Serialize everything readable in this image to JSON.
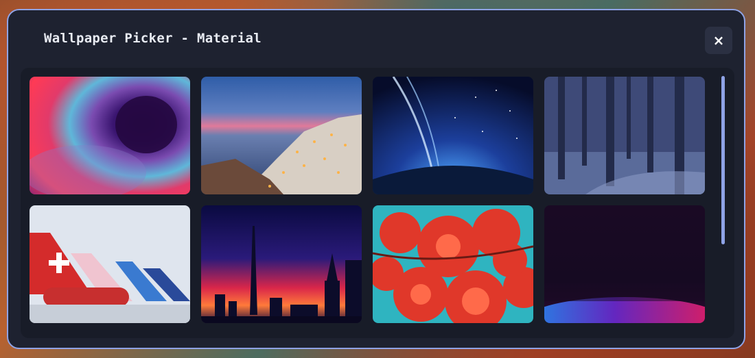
{
  "dialog": {
    "title": "Wallpaper Picker - Material",
    "close_label": "×"
  },
  "wallpapers": [
    {
      "name": "nebula-vortex"
    },
    {
      "name": "santorini-sunset"
    },
    {
      "name": "starry-night-wave"
    },
    {
      "name": "winter-forest"
    },
    {
      "name": "airplane-tails"
    },
    {
      "name": "neon-city-skyline"
    },
    {
      "name": "red-maple-leaves"
    },
    {
      "name": "dark-gradient"
    }
  ],
  "colors": {
    "accent": "#8fa3e6",
    "window_bg": "#1e2230",
    "panel_bg": "#181c28"
  }
}
